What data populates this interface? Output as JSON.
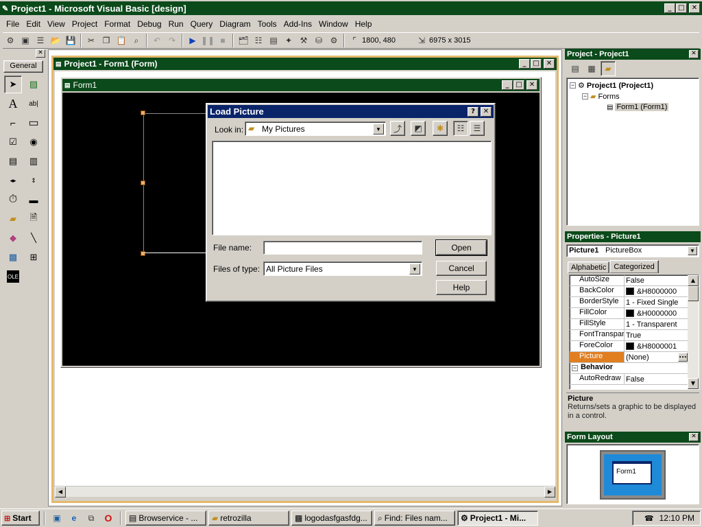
{
  "app": {
    "title": "Project1 - Microsoft Visual Basic [design]",
    "menu": [
      "File",
      "Edit",
      "View",
      "Project",
      "Format",
      "Debug",
      "Run",
      "Query",
      "Diagram",
      "Tools",
      "Add-Ins",
      "Window",
      "Help"
    ],
    "position_readout": "1800, 480",
    "size_readout": "6975 x 3015"
  },
  "toolbox": {
    "title": "General"
  },
  "designer": {
    "title": "Project1 - Form1 (Form)",
    "form_title": "Form1"
  },
  "dialog": {
    "title": "Load Picture",
    "look_in_label": "Look in:",
    "look_in_value": "My Pictures",
    "filename_label": "File name:",
    "filename_value": "",
    "filetype_label": "Files of type:",
    "filetype_value": "All Picture Files",
    "open_label": "Open",
    "cancel_label": "Cancel",
    "help_label": "Help"
  },
  "project": {
    "title": "Project - Project1",
    "root": "Project1 (Project1)",
    "folder": "Forms",
    "item": "Form1 (Form1)"
  },
  "properties": {
    "title": "Properties - Picture1",
    "object_name": "Picture1",
    "object_type": "PictureBox",
    "tab_alphabetic": "Alphabetic",
    "tab_categorized": "Categorized",
    "rows": [
      {
        "name": "AutoSize",
        "value": "False",
        "swatch": false
      },
      {
        "name": "BackColor",
        "value": "&H8000000",
        "swatch": true
      },
      {
        "name": "BorderStyle",
        "value": "1 - Fixed Single",
        "swatch": false
      },
      {
        "name": "FillColor",
        "value": "&H0000000",
        "swatch": true
      },
      {
        "name": "FillStyle",
        "value": "1 - Transparent",
        "swatch": false
      },
      {
        "name": "FontTransparent",
        "value": "True",
        "swatch": false
      },
      {
        "name": "ForeColor",
        "value": "&H8000001",
        "swatch": true
      },
      {
        "name": "Picture",
        "value": "(None)",
        "swatch": false,
        "selected": true
      }
    ],
    "category": "Behavior",
    "category_row": {
      "name": "AutoRedraw",
      "value": "False"
    },
    "desc_title": "Picture",
    "desc_text": "Returns/sets a graphic to be displayed in a control."
  },
  "form_layout": {
    "title": "Form Layout",
    "form_label": "Form1"
  },
  "taskbar": {
    "start": "Start",
    "tasks": [
      "Browservice - ...",
      "retrozilla",
      "logodasfgasfdg...",
      "Find: Files nam...",
      "Project1 - Mi..."
    ],
    "clock": "12:10 PM"
  },
  "colors": {
    "titlebar": "#0b4a1a",
    "dialog_title": "#0a246a",
    "form_bg": "#000000",
    "selected_prop": "#e07e20"
  }
}
